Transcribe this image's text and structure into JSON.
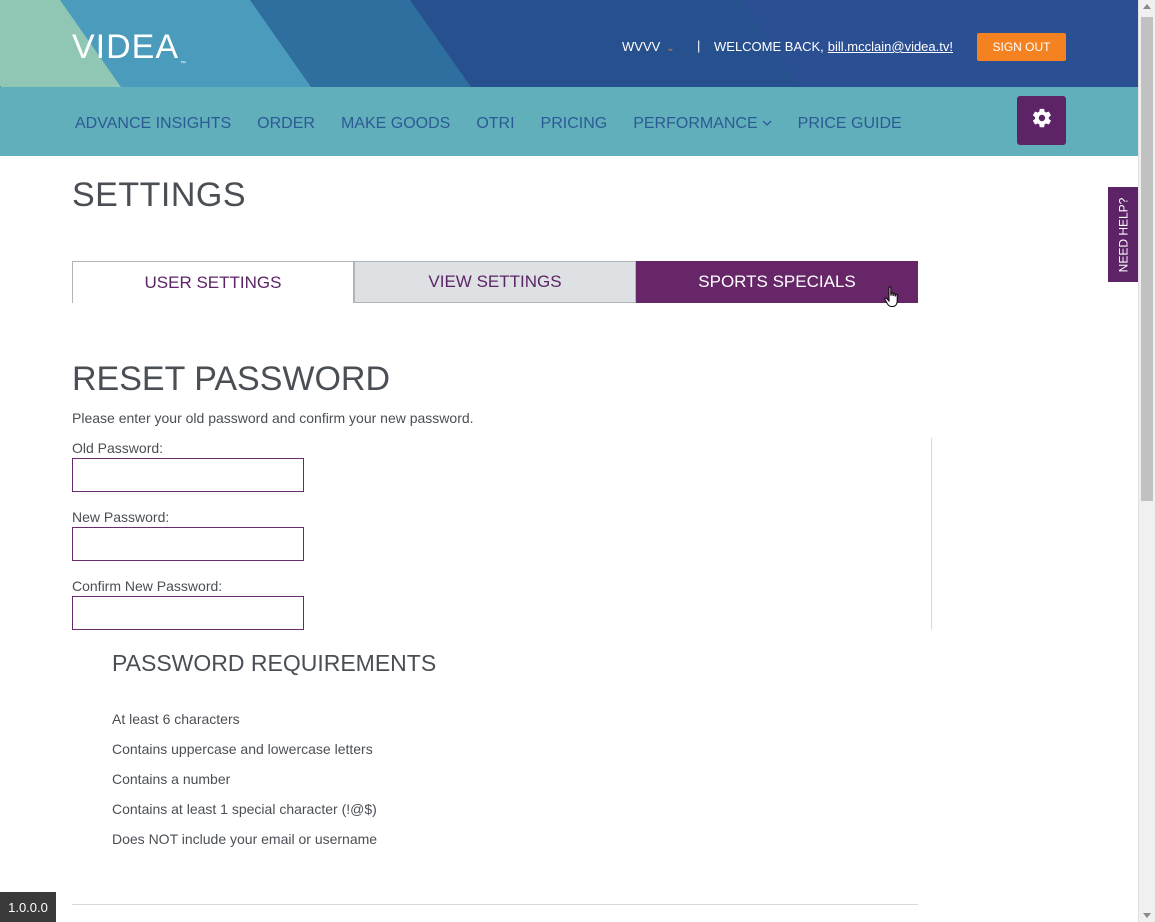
{
  "header": {
    "logo_text": "VIDEA",
    "logo_tm": "™",
    "station": "WVVV",
    "separator": "|",
    "welcome_text": "WELCOME BACK,",
    "user_email": "bill.mcclain@videa.tv!",
    "signout_label": "SIGN OUT"
  },
  "nav": {
    "items": [
      {
        "label": "ADVANCE INSIGHTS"
      },
      {
        "label": "ORDER"
      },
      {
        "label": "MAKE GOODS"
      },
      {
        "label": "OTRI"
      },
      {
        "label": "PRICING"
      },
      {
        "label": "PERFORMANCE"
      },
      {
        "label": "PRICE GUIDE"
      }
    ]
  },
  "page": {
    "title": "SETTINGS"
  },
  "tabs": [
    {
      "label": "USER SETTINGS"
    },
    {
      "label": "VIEW SETTINGS"
    },
    {
      "label": "SPORTS SPECIALS"
    }
  ],
  "reset": {
    "title": "RESET PASSWORD",
    "instructions": "Please enter your old password and confirm your new password.",
    "old_label": "Old Password:",
    "old_value": "",
    "new_label": "New Password:",
    "new_value": "",
    "confirm_label": "Confirm New Password:",
    "confirm_value": ""
  },
  "requirements": {
    "title": "PASSWORD REQUIREMENTS",
    "items": [
      "At least 6 characters",
      "Contains uppercase and lowercase letters",
      "Contains a number",
      "Contains at least 1 special character (!@$)",
      "Does NOT include your email or username"
    ]
  },
  "help": {
    "label": "NEED HELP?"
  },
  "version": "1.0.0.0",
  "colors": {
    "brand_purple": "#5c2466",
    "accent_orange": "#f58220",
    "nav_teal": "#62afbc",
    "header_blue": "#2b4f93"
  }
}
